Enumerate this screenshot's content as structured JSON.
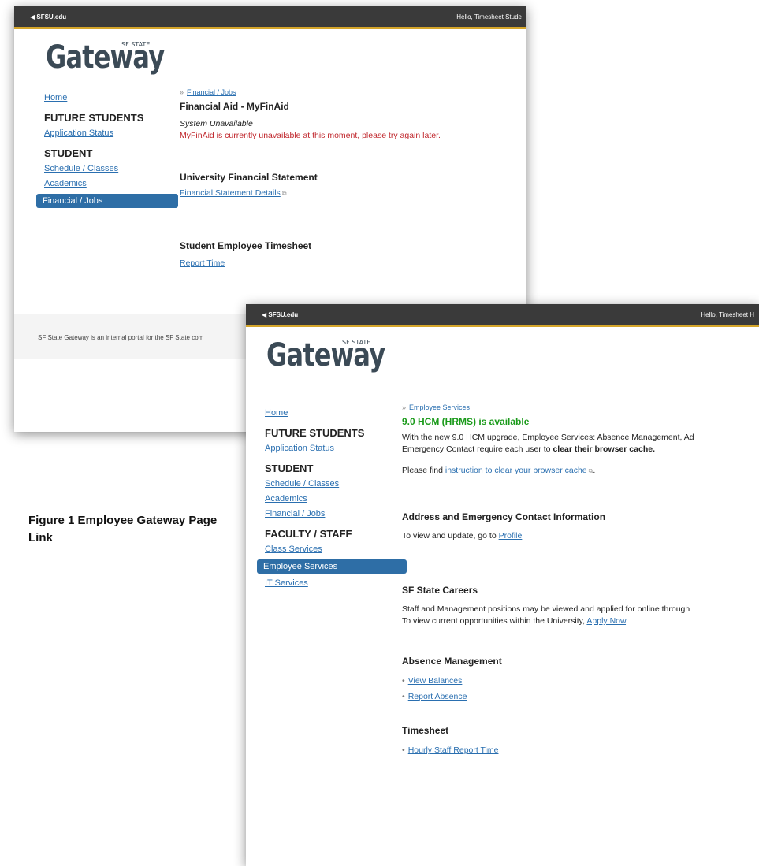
{
  "caption": "Figure 1 Employee Gateway Page Link",
  "shot1": {
    "topbar": {
      "back_label": "◀ SFSU.edu",
      "greeting": "Hello, Timesheet Stude"
    },
    "logo": {
      "word": "Gateway",
      "sf_state": "SF STATE"
    },
    "sidebar": {
      "home": "Home",
      "future_students_header": "FUTURE STUDENTS",
      "application_status": "Application Status",
      "student_header": "STUDENT",
      "schedule_classes": "Schedule / Classes",
      "academics": "Academics",
      "financial_jobs": "Financial / Jobs"
    },
    "main": {
      "breadcrumb": "Financial / Jobs",
      "finaid_title": "Financial Aid - MyFinAid",
      "finaid_status": "System Unavailable",
      "finaid_message": "MyFinAid is currently unavailable at this moment, please try again later.",
      "ufs_title": "University Financial Statement",
      "ufs_link": "Financial Statement Details",
      "timesheet_title": "Student Employee Timesheet",
      "timesheet_link": "Report Time"
    },
    "footer": "SF State Gateway is an internal portal for the SF State com"
  },
  "shot2": {
    "topbar": {
      "back_label": "◀ SFSU.edu",
      "greeting": "Hello, Timesheet H"
    },
    "logo": {
      "word": "Gateway",
      "sf_state": "SF STATE"
    },
    "sidebar": {
      "home": "Home",
      "future_students_header": "FUTURE STUDENTS",
      "application_status": "Application Status",
      "student_header": "STUDENT",
      "schedule_classes": "Schedule / Classes",
      "academics": "Academics",
      "financial_jobs": "Financial / Jobs",
      "faculty_header": "FACULTY / STAFF",
      "class_services": "Class Services",
      "employee_services": "Employee Services",
      "it_services": "IT Services"
    },
    "main": {
      "breadcrumb": "Employee Services",
      "hcm_title": "9.0 HCM (HRMS) is available",
      "hcm_text_1": "With the new 9.0 HCM upgrade, Employee Services: Absence Management, Ad",
      "hcm_text_2a": "Emergency Contact require each user to ",
      "hcm_text_2b": "clear their browser cache.",
      "find_text": "Please find ",
      "find_link": "instruction to clear your browser cache",
      "find_end": ".",
      "address_title": "Address and Emergency Contact Information",
      "address_text": "To view and update, go to ",
      "address_link": "Profile",
      "careers_title": "SF State Careers",
      "careers_text_1": "Staff and Management positions may be viewed and applied for online through",
      "careers_text_2": "To view current opportunities within the University, ",
      "careers_link": "Apply Now",
      "careers_end": ".",
      "absence_title": "Absence Management",
      "absence_links": [
        "View Balances",
        "Report Absence"
      ],
      "timesheet_title": "Timesheet",
      "timesheet_links": [
        "Hourly Staff Report Time"
      ]
    }
  },
  "colors": {
    "topbar": "#3a3a3a",
    "gold_rule": "#d4a52a",
    "active_nav": "#2e6ea6",
    "link": "#2a6fb0",
    "error_red": "#c0272d",
    "success_green": "#1a9a1a"
  },
  "icons": {
    "external_link": "external-link-icon",
    "back_arrow": "back-arrow-icon"
  }
}
